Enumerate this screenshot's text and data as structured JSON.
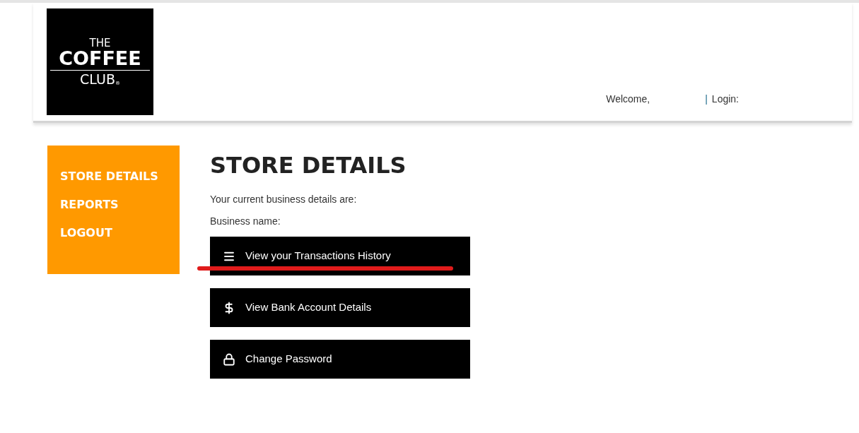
{
  "logo": {
    "lines": [
      "THE",
      "COFFEE",
      "CLUB"
    ],
    "mark": "®"
  },
  "header": {
    "welcome": "Welcome,",
    "separator": "|",
    "login": "Login:"
  },
  "sidebar": {
    "items": [
      "STORE DETAILS",
      "REPORTS",
      "LOGOUT"
    ]
  },
  "main": {
    "title": "STORE DETAILS",
    "lines": [
      "Your current business details are:",
      "Business name:"
    ],
    "actions": [
      {
        "kind": "menu",
        "label": "View your Transactions History",
        "underlined": true
      },
      {
        "kind": "dollar",
        "label": "View Bank Account Details",
        "underlined": false
      },
      {
        "kind": "lock",
        "label": "Change Password",
        "underlined": false
      }
    ]
  }
}
